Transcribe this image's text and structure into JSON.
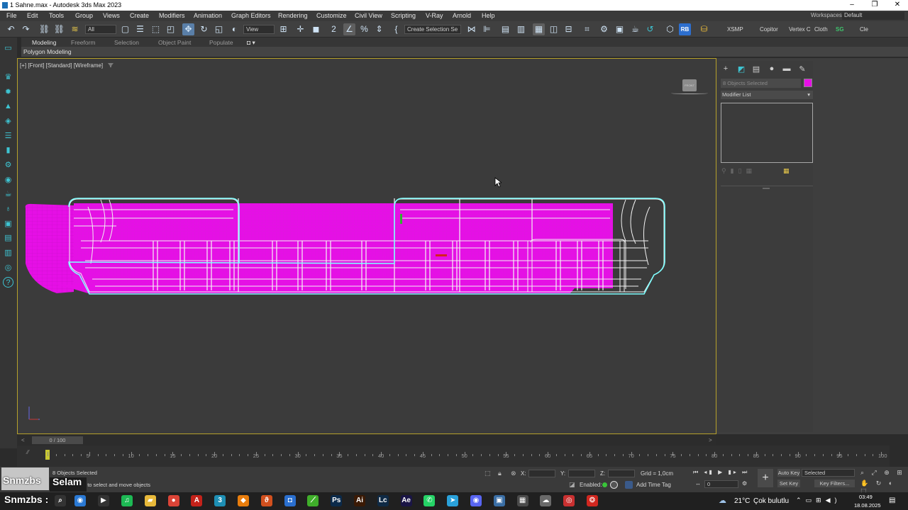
{
  "window": {
    "title": "1 Sahne.max - Autodesk 3ds Max 2023",
    "workspace_label": "Workspaces:",
    "workspace_value": "Default"
  },
  "menu": [
    "File",
    "Edit",
    "Tools",
    "Group",
    "Views",
    "Create",
    "Modifiers",
    "Animation",
    "Graph Editors",
    "Rendering",
    "Customize",
    "Civil View",
    "Scripting",
    "V-Ray",
    "Arnold",
    "Help"
  ],
  "toolbar": {
    "filter_value": "All",
    "view_value": "View",
    "selection_set_placeholder": "Create Selection Se",
    "plugins": [
      "XSMP",
      "Copitor",
      "Vertex C",
      "Cloth",
      "SG",
      "Cle"
    ]
  },
  "ribbon": {
    "tabs": [
      "Modeling",
      "Freeform",
      "Selection",
      "Object Paint",
      "Populate"
    ],
    "active_tab": "Modeling",
    "panel_label": "Polygon Modeling"
  },
  "viewport": {
    "label": "[+] [Front] [Standard] [Wireframe]",
    "viewcube_label": "FRONT",
    "accent_color": "#b6a12b",
    "object_color": "#e60fe6",
    "selection_color": "#7fffff"
  },
  "command_panel": {
    "selection_status": "8 Objects Selected",
    "modifier_list": "Modifier List",
    "object_color": "#e60fe6"
  },
  "timeline": {
    "slider_label": "0 / 100",
    "ticks": [
      0,
      5,
      10,
      15,
      20,
      25,
      30,
      35,
      40,
      45,
      50,
      55,
      60,
      65,
      70,
      75,
      80,
      85,
      90,
      95,
      100
    ]
  },
  "status": {
    "objects_selected": "8 Objects Selected",
    "prompt": "Click or click-and-drag to select and move objects",
    "x_label": "X:",
    "y_label": "Y:",
    "z_label": "Z:",
    "grid": "Grid = 1,0cm",
    "enabled_label": "Enabled:",
    "add_time_tag": "Add Time Tag",
    "auto_key": "Auto Key",
    "set_key": "Set Key",
    "key_mode_value": "Selected",
    "key_filters": "Key Filters...",
    "frame_value": "0"
  },
  "overlay": {
    "channel_small": "Snmzbs",
    "greeting": "Selam",
    "channel_large": "Snmzbs :"
  },
  "taskbar": {
    "weather_temp": "21°C",
    "weather_text": "Çok bulutlu",
    "time": "03:49",
    "date": "18.08.2025",
    "apps": [
      {
        "name": "spotify",
        "label": "♫",
        "color": "#1db954"
      },
      {
        "name": "files",
        "label": "▰",
        "color": "#e8b93a"
      },
      {
        "name": "chrome",
        "label": "●",
        "color": "#db4437"
      },
      {
        "name": "acrobat",
        "label": "A",
        "color": "#c4221a"
      },
      {
        "name": "3dsmax",
        "label": "3",
        "color": "#1e8fb4"
      },
      {
        "name": "blender",
        "label": "◆",
        "color": "#e87d0d"
      },
      {
        "name": "app-orange",
        "label": "ϑ",
        "color": "#d2501e"
      },
      {
        "name": "app-blue",
        "label": "◘",
        "color": "#2a6fcf"
      },
      {
        "name": "app-green",
        "label": "⟋",
        "color": "#3fae2a"
      },
      {
        "name": "photoshop",
        "label": "Ps",
        "color": "#0b2a4a"
      },
      {
        "name": "illustrator",
        "label": "Ai",
        "color": "#3b1a05"
      },
      {
        "name": "lightroom",
        "label": "Lc",
        "color": "#0f2a45"
      },
      {
        "name": "after-effects",
        "label": "Ae",
        "color": "#1a1545"
      },
      {
        "name": "whatsapp",
        "label": "✆",
        "color": "#25d366"
      },
      {
        "name": "telegram",
        "label": "➤",
        "color": "#2aa1da"
      },
      {
        "name": "discord",
        "label": "◉",
        "color": "#5865f2"
      },
      {
        "name": "remote",
        "label": "▣",
        "color": "#3a6ea5"
      },
      {
        "name": "calculator",
        "label": "▦",
        "color": "#4a4a4a"
      },
      {
        "name": "app-grey",
        "label": "☁",
        "color": "#6a6a6a"
      },
      {
        "name": "app-red",
        "label": "◎",
        "color": "#c93030"
      },
      {
        "name": "app-red2",
        "label": "❂",
        "color": "#d1271f"
      }
    ]
  }
}
